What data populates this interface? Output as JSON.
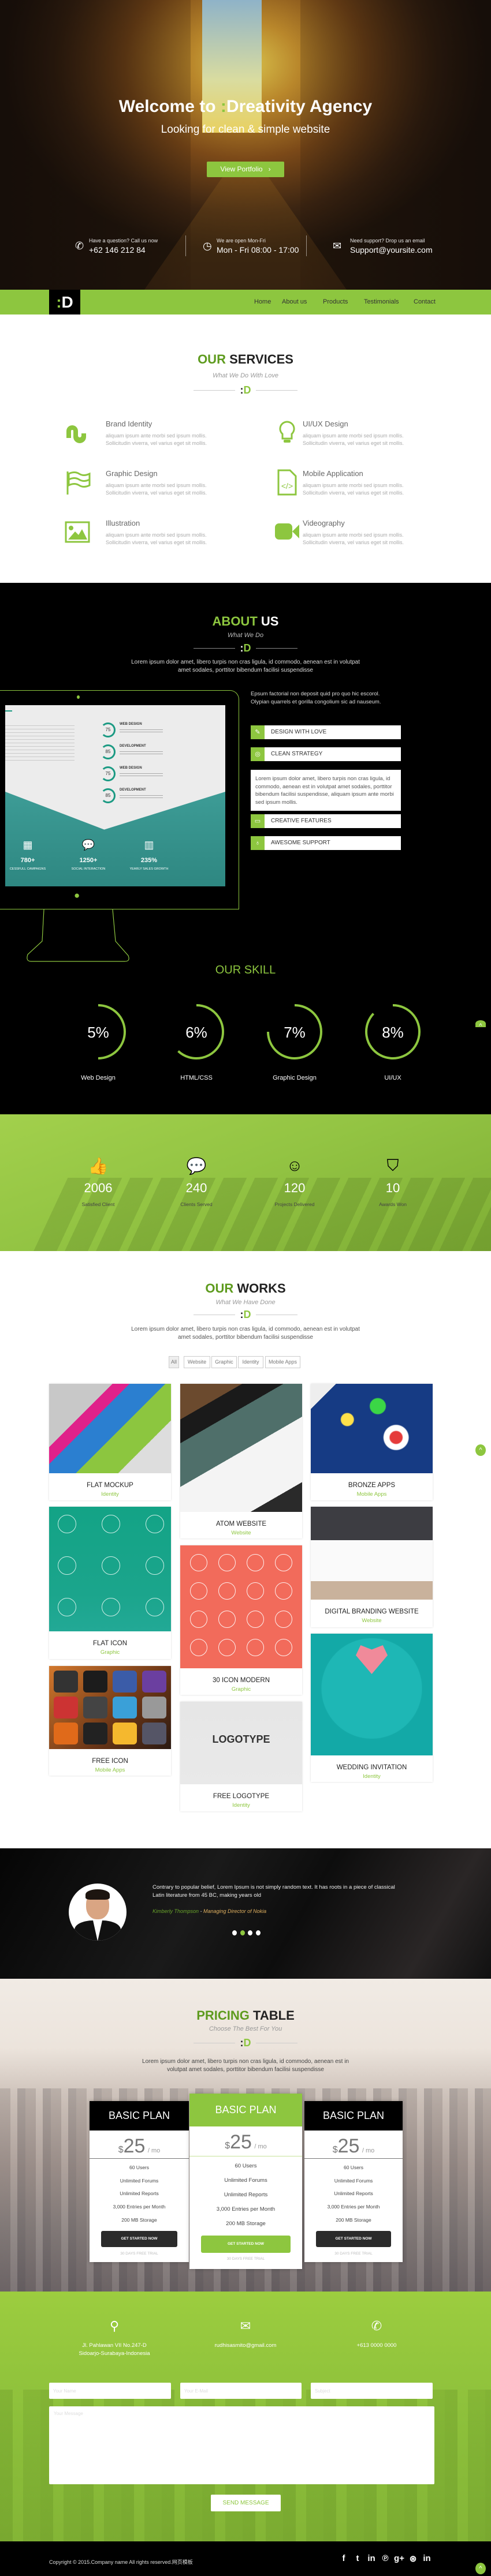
{
  "brand": {
    "accent": "#8dc63f",
    "logo_colon": ":",
    "logo_letter": "D"
  },
  "hero": {
    "title_prefix": "Welcome to ",
    "title_mark": ":",
    "title_suffix": "Dreativity Agency",
    "subtitle": "Looking for clean & simple website",
    "cta": "View Portfolio",
    "cta_arrow": "›",
    "info": [
      {
        "icon": "phone-icon",
        "glyph": "✆",
        "label": "Have a question? Call us now",
        "value": "+62 146 212 84"
      },
      {
        "icon": "clock-icon",
        "glyph": "◷",
        "label": "We are open Mon-Fri",
        "value": "Mon - Fri 08:00 - 17:00"
      },
      {
        "icon": "envelope-icon",
        "glyph": "✉",
        "label": "Need support? Drop us an email",
        "value": "Support@yoursite.com"
      }
    ]
  },
  "nav": {
    "items": [
      "Home",
      "About us",
      "Products",
      "Testimonials",
      "Contact"
    ]
  },
  "services": {
    "title_green": "OUR",
    "title_dark": "SERVICES",
    "subtitle": "What We Do With Love",
    "items": [
      {
        "icon": "stumbleupon-icon",
        "title": "Brand Identity",
        "line1": "aliquam ipsum ante morbi sed ipsum mollis.",
        "line2": "Sollicitudin viverra, vel varius eget sit mollis."
      },
      {
        "icon": "lightbulb-icon",
        "title": "UI/UX Design",
        "line1": "aliquam ipsum ante morbi sed ipsum mollis.",
        "line2": "Sollicitudin viverra, vel varius eget sit mollis."
      },
      {
        "icon": "flag-icon",
        "title": "Graphic Design",
        "line1": "aliquam ipsum ante morbi sed ipsum mollis.",
        "line2": "Sollicitudin viverra, vel varius eget sit mollis."
      },
      {
        "icon": "code-file-icon",
        "title": "Mobile Application",
        "line1": "aliquam ipsum ante morbi sed ipsum mollis.",
        "line2": "Sollicitudin viverra, vel varius eget sit mollis."
      },
      {
        "icon": "image-icon",
        "title": "Illustration",
        "line1": "aliquam ipsum ante morbi sed ipsum mollis.",
        "line2": "Sollicitudin viverra, vel varius eget sit mollis."
      },
      {
        "icon": "video-camera-icon",
        "title": "Videography",
        "line1": "aliquam ipsum ante morbi sed ipsum mollis.",
        "line2": "Sollicitudin viverra, vel varius eget sit mollis."
      }
    ]
  },
  "about": {
    "title_green": "ABOUT",
    "title_dark": "US",
    "subtitle": "What We Do",
    "intro_1": "Lorem ipsum dolor amet, libero turpis non cras ligula, id commodo, aenean est in volutpat",
    "intro_2": "amet sodales, porttitor bibendum facilisi suspendisse",
    "side_1": "Epsum factorial non deposit quid pro quo hic escorol.",
    "side_2": "Olypian quarrels et gorilla congolium sic ad nauseum.",
    "accordion": [
      {
        "icon": "pencil-icon",
        "glyph": "✎",
        "label": "DESIGN WITH LOVE"
      },
      {
        "icon": "lifebuoy-icon",
        "glyph": "◎",
        "label": "CLEAN STRATEGY"
      },
      {
        "icon": "laptop-icon",
        "glyph": "▭",
        "label": "CREATIVE FEATURES"
      },
      {
        "icon": "bulb-icon",
        "glyph": "♁",
        "label": "AWESOME SUPPORT"
      }
    ],
    "panel_text": "Lorem ipsum dolor amet, libero turpis non cras ligula, id commodo, aenean est in volutpat amet sodales, porttitor bibendum facilisi suspendisse, aliquam ipsum ante morbi sed ipsum mollis.",
    "monitor_screen": {
      "rings": [
        {
          "label": "WEB DESIGN",
          "value": "75"
        },
        {
          "label": "DEVELOPMENT",
          "value": "85"
        },
        {
          "label": "WEB DESIGN",
          "value": "75"
        },
        {
          "label": "DEVELOPMENT",
          "value": "85"
        }
      ],
      "stats": [
        {
          "value": "780+",
          "label": "CESSFULL CAMPAIGNS"
        },
        {
          "value": "1250+",
          "label": "SOCIAL INTERACTION"
        },
        {
          "value": "235%",
          "label": "YEARLY SALES GROWTH"
        }
      ]
    }
  },
  "skills": {
    "title": "OUR SKILL",
    "items": [
      {
        "percent": "5%",
        "label": "Web Design",
        "arc_fill": 0.5
      },
      {
        "percent": "6%",
        "label": "HTML/CSS",
        "arc_fill": 0.62
      },
      {
        "percent": "7%",
        "label": "Graphic Design",
        "arc_fill": 0.75
      },
      {
        "percent": "8%",
        "label": "UI/UX",
        "arc_fill": 0.87
      }
    ]
  },
  "stats": [
    {
      "icon": "thumbs-up-icon",
      "glyph": "👍",
      "value": "2006",
      "label": "Satisfied Client"
    },
    {
      "icon": "chat-bubbles-icon",
      "glyph": "💬",
      "value": "240",
      "label": "Clients Served"
    },
    {
      "icon": "smiley-icon",
      "glyph": "☺",
      "value": "120",
      "label": "Projects Delivered"
    },
    {
      "icon": "bookmark-icon",
      "glyph": "⛉",
      "value": "10",
      "label": "Awards Won"
    }
  ],
  "works": {
    "title_green": "OUR",
    "title_dark": "WORKS",
    "subtitle": "What We Have Done",
    "intro_1": "Lorem ipsum dolor amet, libero turpis non cras ligula, id commodo, aenean est in volutpat",
    "intro_2": "amet sodales, porttitor bibendum facilisi suspendisse",
    "filters": [
      "All",
      "Website",
      "Graphic",
      "Identity",
      "Mobile Apps"
    ],
    "active_filter": "All",
    "items": [
      {
        "title": "FLAT MOCKUP",
        "category": "Identity"
      },
      {
        "title": "ATOM WEBSITE",
        "category": "Website"
      },
      {
        "title": "BRONZE APPS",
        "category": "Mobile Apps"
      },
      {
        "title": "FLAT ICON",
        "category": "Graphic"
      },
      {
        "title": "DIGITAL BRANDING WEBSITE",
        "category": "Website"
      },
      {
        "title": "30 ICON MODERN",
        "category": "Graphic"
      },
      {
        "title": "FREE ICON",
        "category": "Mobile Apps"
      },
      {
        "title": "FREE LOGOTYPE",
        "category": "Identity"
      },
      {
        "title": "WEDDING INVITATION",
        "category": "Identity"
      }
    ]
  },
  "testimonial": {
    "quote": "Contrary to popular belief, Lorem Ipsum is not simply random text. It has roots in a piece of classical Latin literature from 45 BC, making years old",
    "name": "Kimberly Thompson",
    "separator": " - ",
    "role": "Managing Director of Nokia",
    "slides": 4,
    "active_slide": 2
  },
  "pricing": {
    "title_green": "PRICING",
    "title_dark": "TABLE",
    "subtitle": "Choose The Best For You",
    "intro_1": "Lorem ipsum dolor amet, libero turpis non cras ligula, id commodo, aenean est in",
    "intro_2": "volutpat amet sodales, porttitor bibendum facilisi suspendisse",
    "plans": [
      {
        "name": "BASIC PLAN",
        "currency": "$",
        "price": "25",
        "period": "/ mo",
        "features": [
          "60 Users",
          "Unlimited Forums",
          "Unlimited Reports",
          "3,000 Entries per Month",
          "200 MB Storage"
        ],
        "button": "GET STARTED NOW",
        "trial": "30 DAYS FREE TRIAL",
        "featured": false
      },
      {
        "name": "BASIC PLAN",
        "currency": "$",
        "price": "25",
        "period": "/ mo",
        "features": [
          "60 Users",
          "Unlimited Forums",
          "Unlimited Reports",
          "3,000 Entries per Month",
          "200 MB Storage"
        ],
        "button": "GET STARTED NOW",
        "trial": "30 DAYS FREE TRIAL",
        "featured": true
      },
      {
        "name": "BASIC PLAN",
        "currency": "$",
        "price": "25",
        "period": "/ mo",
        "features": [
          "60 Users",
          "Unlimited Forums",
          "Unlimited Reports",
          "3,000 Entries per Month",
          "200 MB Storage"
        ],
        "button": "GET STARTED NOW",
        "trial": "30 DAYS FREE TRIAL",
        "featured": false
      }
    ]
  },
  "contact": {
    "address_1": "Jl. Pahlawan VII No.247-D",
    "address_2": "Sidoarjo-Surabaya-Indonesia",
    "email": "rudhisasmito@gmail.com",
    "phone": "+613 0000 0000",
    "form": {
      "name_placeholder": "Your Name",
      "email_placeholder": "Your E-Mail",
      "subject_placeholder": "Subject",
      "message_placeholder": "Your Message",
      "send": "SEND MESSAGE"
    }
  },
  "footer": {
    "copyright": "Copyright © 2015.Company name All rights reserved.网页模板",
    "social": [
      {
        "icon": "facebook-icon",
        "glyph": "f"
      },
      {
        "icon": "twitter-icon",
        "glyph": "t"
      },
      {
        "icon": "linkedin-icon",
        "glyph": "in"
      },
      {
        "icon": "pinterest-icon",
        "glyph": "℗"
      },
      {
        "icon": "google-plus-icon",
        "glyph": "g+"
      },
      {
        "icon": "dribbble-icon",
        "glyph": "⊛"
      },
      {
        "icon": "linkedin-icon-2",
        "glyph": "in"
      }
    ],
    "back_to_top": "^"
  }
}
